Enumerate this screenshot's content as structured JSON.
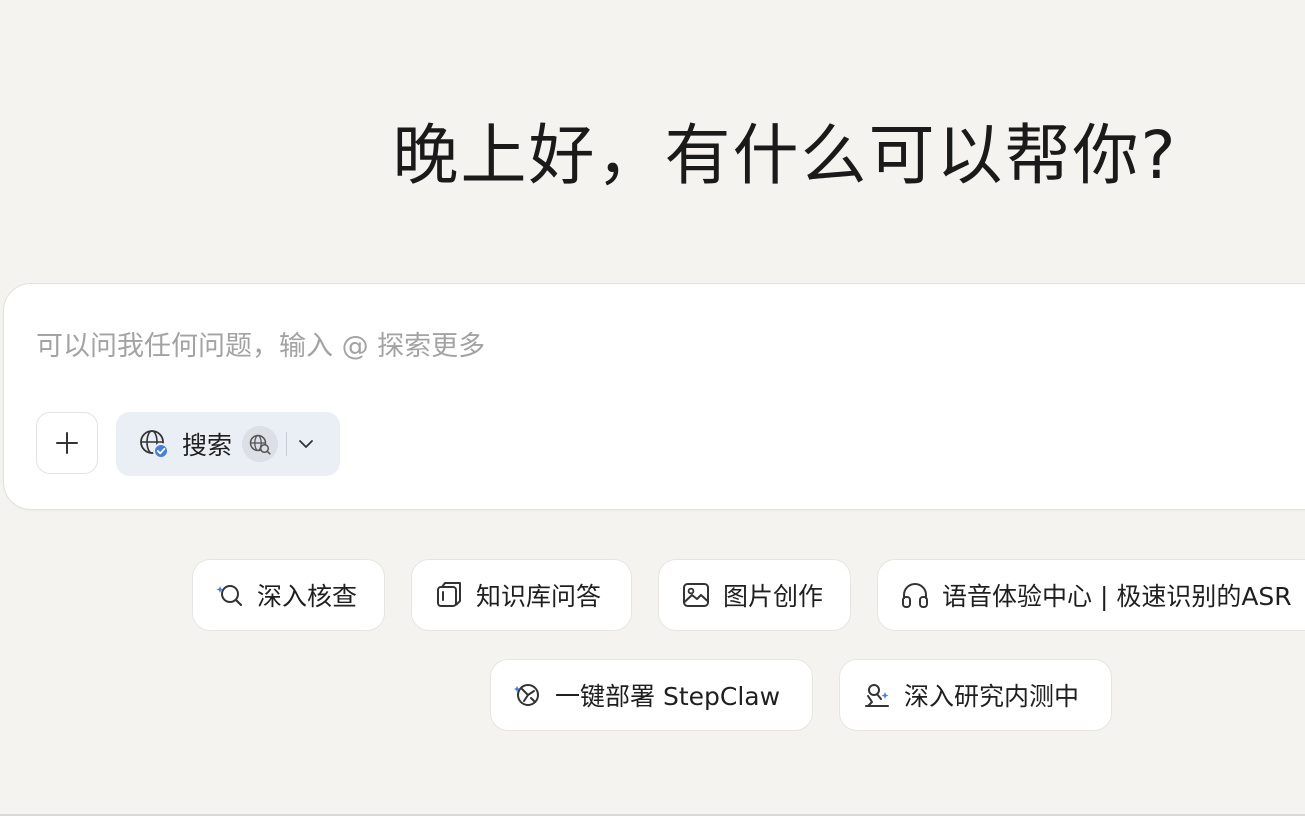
{
  "greeting": "晚上好，有什么可以帮你?",
  "composer": {
    "placeholder": "可以问我任何问题，输入 @ 探索更多",
    "search_label": "搜索"
  },
  "suggestions": [
    {
      "label": "深入核查",
      "icon": "deep-check-icon"
    },
    {
      "label": "知识库问答",
      "icon": "knowledge-base-icon"
    },
    {
      "label": "图片创作",
      "icon": "image-icon"
    },
    {
      "label": "语音体验中心 | 极速识别的ASR",
      "icon": "headphones-icon"
    },
    {
      "label": "一键部署 StepClaw",
      "icon": "deploy-icon"
    },
    {
      "label": "深入研究内测中",
      "icon": "research-icon"
    }
  ],
  "colors": {
    "background": "#f4f3f0",
    "chip": "#eaeef5",
    "accent": "#4a7fd8"
  }
}
